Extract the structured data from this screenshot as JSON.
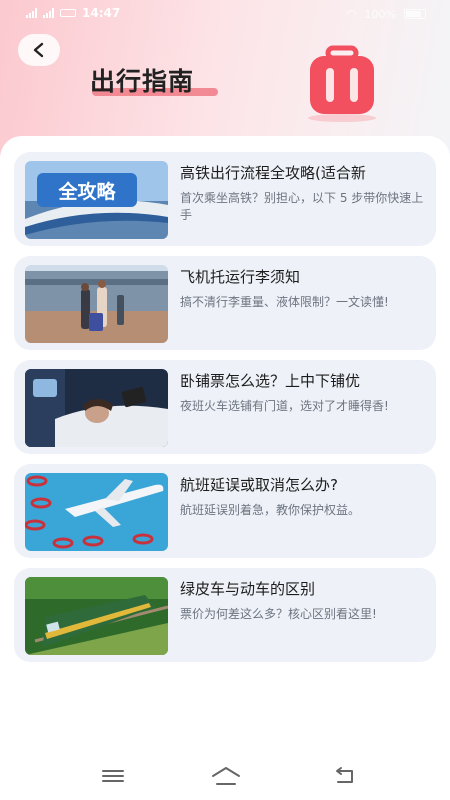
{
  "status_bar": {
    "time": "14:47",
    "network_left": "5G",
    "network_left2": "4G",
    "right_text": "100%"
  },
  "header": {
    "title": "出行指南"
  },
  "articles": [
    {
      "title": "高铁出行流程全攻略(适合新",
      "desc": "首次乘坐高铁？别担心，以下 5 步带你快速上手",
      "badge": "全攻略"
    },
    {
      "title": "飞机托运行李须知",
      "desc": "搞不清行李重量、液体限制？一文读懂!"
    },
    {
      "title": "卧铺票怎么选？上中下铺优",
      "desc": "夜班火车选铺有门道，选对了才睡得香!"
    },
    {
      "title": "航班延误或取消怎么办?",
      "desc": "航班延误别着急，教你保护权益。"
    },
    {
      "title": "绿皮车与动车的区别",
      "desc": "票价为何差这么多？核心区别看这里!"
    }
  ],
  "colors": {
    "accent": "#f07a86",
    "card_bg": "#eef2f8",
    "suitcase": "#f2505f"
  },
  "icons": [
    "back-arrow-icon",
    "suitcase-icon",
    "menu-icon",
    "home-icon",
    "return-icon"
  ]
}
